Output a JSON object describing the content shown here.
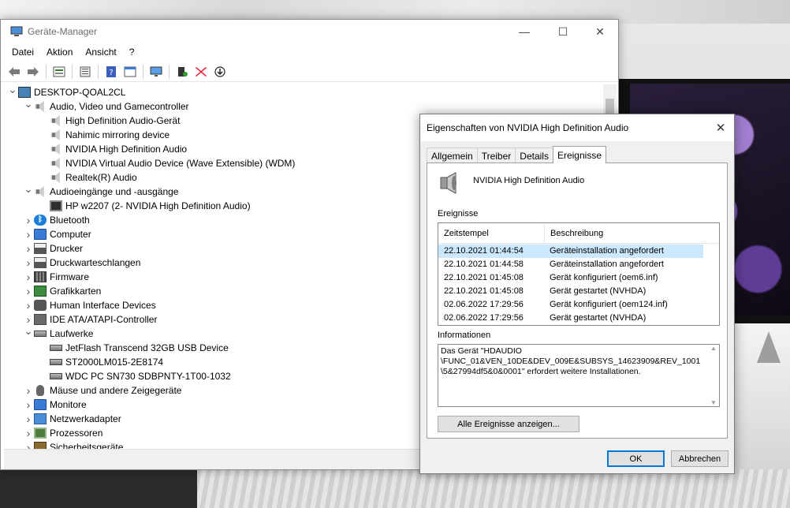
{
  "device_manager": {
    "title": "Geräte-Manager",
    "window_controls": {
      "minimize": "—",
      "maximize": "☐",
      "close": "✕"
    },
    "menu": [
      "Datei",
      "Aktion",
      "Ansicht",
      "?"
    ],
    "toolbar_icons": [
      "back-arrow-icon",
      "forward-arrow-icon",
      "properties-icon",
      "driver-icon",
      "help-icon",
      "view-icon",
      "scan-monitor-icon",
      "add-driver-icon",
      "uninstall-icon",
      "update-icon"
    ],
    "tree": [
      {
        "label": "DESKTOP-QOAL2CL",
        "level": 0,
        "expander": "expanded",
        "icon": "computer-root-icon"
      },
      {
        "label": "Audio, Video und Gamecontroller",
        "level": 1,
        "expander": "expanded",
        "icon": "speaker-icon"
      },
      {
        "label": "High Definition Audio-Gerät",
        "level": 2,
        "expander": "none",
        "icon": "speaker-icon"
      },
      {
        "label": "Nahimic mirroring device",
        "level": 2,
        "expander": "none",
        "icon": "speaker-icon"
      },
      {
        "label": "NVIDIA High Definition Audio",
        "level": 2,
        "expander": "none",
        "icon": "speaker-icon"
      },
      {
        "label": "NVIDIA Virtual Audio Device (Wave Extensible) (WDM)",
        "level": 2,
        "expander": "none",
        "icon": "speaker-icon"
      },
      {
        "label": "Realtek(R) Audio",
        "level": 2,
        "expander": "none",
        "icon": "speaker-icon"
      },
      {
        "label": "Audioeingänge und -ausgänge",
        "level": 1,
        "expander": "expanded",
        "icon": "speaker-icon"
      },
      {
        "label": "HP w2207 (2- NVIDIA High Definition Audio)",
        "level": 2,
        "expander": "none",
        "icon": "monitor-icon"
      },
      {
        "label": "Bluetooth",
        "level": 1,
        "expander": "collapsed",
        "icon": "bluetooth-icon"
      },
      {
        "label": "Computer",
        "level": 1,
        "expander": "collapsed",
        "icon": "computer-icon"
      },
      {
        "label": "Drucker",
        "level": 1,
        "expander": "collapsed",
        "icon": "printer-icon"
      },
      {
        "label": "Druckwarteschlangen",
        "level": 1,
        "expander": "collapsed",
        "icon": "printer-icon"
      },
      {
        "label": "Firmware",
        "level": 1,
        "expander": "collapsed",
        "icon": "firmware-icon"
      },
      {
        "label": "Grafikkarten",
        "level": 1,
        "expander": "collapsed",
        "icon": "gpu-icon"
      },
      {
        "label": "Human Interface Devices",
        "level": 1,
        "expander": "collapsed",
        "icon": "hid-icon"
      },
      {
        "label": "IDE ATA/ATAPI-Controller",
        "level": 1,
        "expander": "collapsed",
        "icon": "ide-icon"
      },
      {
        "label": "Laufwerke",
        "level": 1,
        "expander": "expanded",
        "icon": "drive-icon"
      },
      {
        "label": "JetFlash Transcend 32GB USB Device",
        "level": 2,
        "expander": "none",
        "icon": "drive-icon"
      },
      {
        "label": "ST2000LM015-2E8174",
        "level": 2,
        "expander": "none",
        "icon": "drive-icon"
      },
      {
        "label": "WDC PC SN730 SDBPNTY-1T00-1032",
        "level": 2,
        "expander": "none",
        "icon": "drive-icon"
      },
      {
        "label": "Mäuse und andere Zeigegeräte",
        "level": 1,
        "expander": "collapsed",
        "icon": "mouse-icon"
      },
      {
        "label": "Monitore",
        "level": 1,
        "expander": "collapsed",
        "icon": "computer-icon"
      },
      {
        "label": "Netzwerkadapter",
        "level": 1,
        "expander": "collapsed",
        "icon": "network-icon"
      },
      {
        "label": "Prozessoren",
        "level": 1,
        "expander": "collapsed",
        "icon": "cpu-icon"
      },
      {
        "label": "Sicherheitsgeräte",
        "level": 1,
        "expander": "collapsed",
        "icon": "security-icon"
      }
    ]
  },
  "properties_dialog": {
    "title": "Eigenschaften von NVIDIA High Definition Audio",
    "close_glyph": "✕",
    "tabs": [
      {
        "label": "Allgemein",
        "active": false
      },
      {
        "label": "Treiber",
        "active": false
      },
      {
        "label": "Details",
        "active": false
      },
      {
        "label": "Ereignisse",
        "active": true
      }
    ],
    "device_name": "NVIDIA High Definition Audio",
    "events_label": "Ereignisse",
    "columns": [
      "Zeitstempel",
      "Beschreibung"
    ],
    "events": [
      {
        "timestamp": "22.10.2021 01:44:54",
        "description": "Geräteinstallation angefordert",
        "selected": true
      },
      {
        "timestamp": "22.10.2021 01:44:58",
        "description": "Geräteinstallation angefordert",
        "selected": false
      },
      {
        "timestamp": "22.10.2021 01:45:08",
        "description": "Gerät konfiguriert (oem6.inf)",
        "selected": false
      },
      {
        "timestamp": "22.10.2021 01:45:08",
        "description": "Gerät gestartet (NVHDA)",
        "selected": false
      },
      {
        "timestamp": "02.06.2022 17:29:56",
        "description": "Gerät konfiguriert (oem124.inf)",
        "selected": false
      },
      {
        "timestamp": "02.06.2022 17:29:56",
        "description": "Gerät gestartet (NVHDA)",
        "selected": false
      }
    ],
    "info_label": "Informationen",
    "info_text": "Das Gerät \"HDAUDIO\n\\FUNC_01&VEN_10DE&DEV_009E&SUBSYS_14623909&REV_1001\n\\5&27994df5&0&0001\" erfordert weitere Installationen.",
    "show_all_button": "Alle Ereignisse anzeigen...",
    "ok_button": "OK",
    "cancel_button": "Abbrechen"
  },
  "colors": {
    "selection": "#cce8ff",
    "primary_button_border": "#0078d7",
    "remove_red": "#e81123"
  }
}
